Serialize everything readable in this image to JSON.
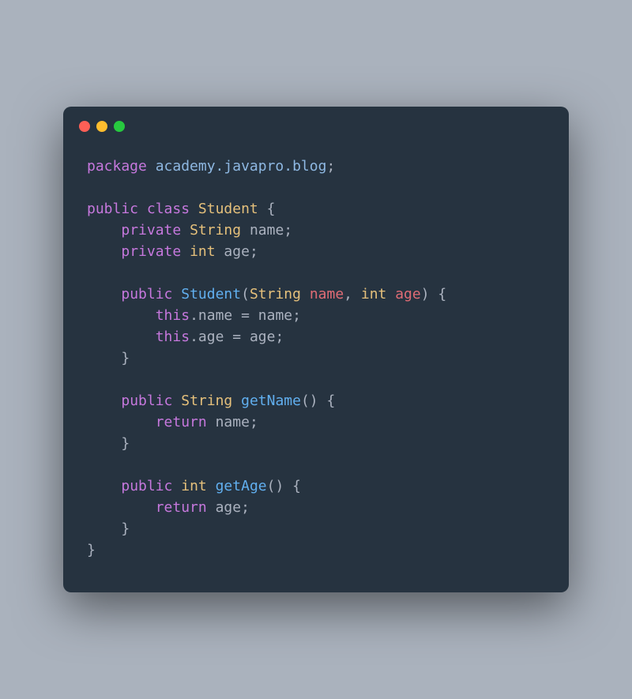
{
  "window": {
    "buttons": {
      "close_color": "#ff5f56",
      "minimize_color": "#ffbd2e",
      "maximize_color": "#27c93f"
    }
  },
  "code": {
    "line01": {
      "kw_package": "package",
      "ns": " academy.javapro.blog",
      "semi": ";"
    },
    "line03": {
      "kw_public": "public",
      "sp1": " ",
      "kw_class": "class",
      "sp2": " ",
      "cls": "Student",
      "open": " {"
    },
    "line04": {
      "indent": "    ",
      "kw_private": "private",
      "sp1": " ",
      "type": "String",
      "sp2": " ",
      "field": "name",
      "semi": ";"
    },
    "line05": {
      "indent": "    ",
      "kw_private": "private",
      "sp1": " ",
      "type": "int",
      "sp2": " ",
      "field": "age",
      "semi": ";"
    },
    "line07": {
      "indent": "    ",
      "kw_public": "public",
      "sp1": " ",
      "ctor": "Student",
      "lparen": "(",
      "ptype1": "String",
      "sp2": " ",
      "pname1": "name",
      "comma": ", ",
      "ptype2": "int",
      "sp3": " ",
      "pname2": "age",
      "rparen": ")",
      "open": " {"
    },
    "line08": {
      "indent": "        ",
      "this": "this",
      "dot": ".",
      "field": "name",
      "eq": " = ",
      "val": "name",
      "semi": ";"
    },
    "line09": {
      "indent": "        ",
      "this": "this",
      "dot": ".",
      "field": "age",
      "eq": " = ",
      "val": "age",
      "semi": ";"
    },
    "line10": {
      "indent": "    ",
      "close": "}"
    },
    "line12": {
      "indent": "    ",
      "kw_public": "public",
      "sp1": " ",
      "rtype": "String",
      "sp2": " ",
      "method": "getName",
      "parens": "()",
      "open": " {"
    },
    "line13": {
      "indent": "        ",
      "kw_return": "return",
      "sp1": " ",
      "val": "name",
      "semi": ";"
    },
    "line14": {
      "indent": "    ",
      "close": "}"
    },
    "line16": {
      "indent": "    ",
      "kw_public": "public",
      "sp1": " ",
      "rtype": "int",
      "sp2": " ",
      "method": "getAge",
      "parens": "()",
      "open": " {"
    },
    "line17": {
      "indent": "        ",
      "kw_return": "return",
      "sp1": " ",
      "val": "age",
      "semi": ";"
    },
    "line18": {
      "indent": "    ",
      "close": "}"
    },
    "line19": {
      "close": "}"
    }
  }
}
